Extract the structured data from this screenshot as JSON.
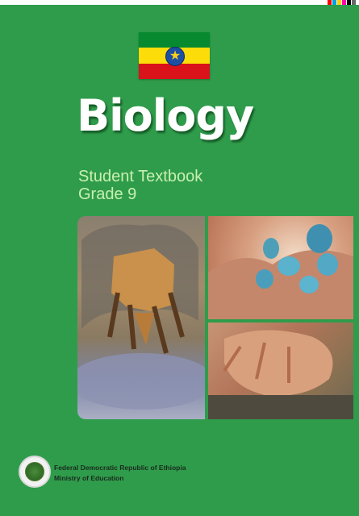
{
  "title": "Biology",
  "subtitle": {
    "line1": "Student Textbook",
    "line2": "Grade 9"
  },
  "publisher": {
    "line1": "Federal Democratic Republic of Ethiopia",
    "line2": "Ministry of Education"
  },
  "flag": {
    "colors": [
      "#078930",
      "#fcdd09",
      "#da121a"
    ],
    "emblem": "#1d4fa5"
  },
  "background_color": "#2f9c4b",
  "photos": [
    "insect-photo",
    "blue-eggs-photo",
    "hand-photo"
  ],
  "swatches": [
    "#ff0000",
    "#00a0e0",
    "#ffd000",
    "#ff00aa",
    "#000000",
    "#666666"
  ]
}
